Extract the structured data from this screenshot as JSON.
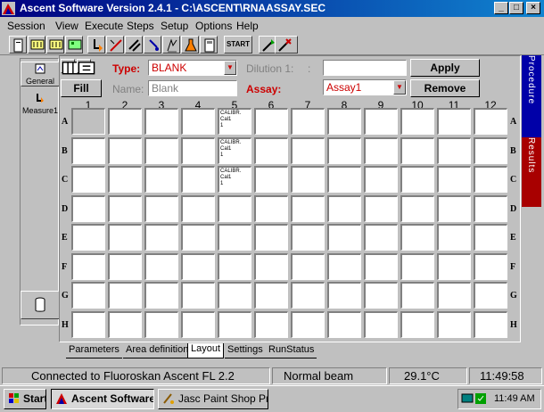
{
  "window": {
    "title": "Ascent Software Version 2.4.1     - C:\\ASCENT\\RNAASSAY.SEC",
    "minimize": "_",
    "maximize": "□",
    "close": "×"
  },
  "menu": [
    "Session",
    "View",
    "Execute",
    "Steps",
    "Setup",
    "Options",
    "Help"
  ],
  "toolbar": {
    "start_label": "START"
  },
  "leftnav": {
    "general": "General",
    "measure": "Measure1"
  },
  "form": {
    "type_label": "Type:",
    "type_value": "BLANK",
    "dilution_label": "Dilution 1:",
    "dilution_suffix": ":",
    "dilution_value": "",
    "apply": "Apply",
    "fill": "Fill",
    "name_label": "Name:",
    "name_value": "Blank",
    "assay_label": "Assay:",
    "assay_value": "Assay1",
    "remove": "Remove"
  },
  "plate": {
    "columns": [
      "1",
      "2",
      "3",
      "4",
      "5",
      "6",
      "7",
      "8",
      "9",
      "10",
      "11",
      "12"
    ],
    "rows": [
      "A",
      "B",
      "C",
      "D",
      "E",
      "F",
      "G",
      "H"
    ],
    "wells": {
      "A5": [
        "CALIBR.",
        "Cal1",
        "1"
      ],
      "B5": [
        "CALIBR.",
        "Cal1",
        "1"
      ],
      "C5": [
        "CALIBR.",
        "Cal1",
        "1"
      ]
    },
    "selected": "A1"
  },
  "tabs": [
    {
      "label": "Parameters",
      "active": false
    },
    {
      "label": "Area definition",
      "active": false
    },
    {
      "label": "Layout",
      "active": true
    },
    {
      "label": "Settings",
      "active": false
    },
    {
      "label": "RunStatus",
      "active": false
    }
  ],
  "side_tabs": {
    "procedure": "Procedure",
    "results": "Results"
  },
  "status": {
    "connection": "Connected to Fluoroskan Ascent FL 2.2",
    "mode": "Normal beam",
    "temperature": "29.1°C",
    "time": "11:49:58"
  },
  "taskbar": {
    "start": "Start",
    "apps": [
      {
        "label": "Ascent Software ...",
        "active": true
      },
      {
        "label": "Jasc Paint Shop Pro...",
        "active": false
      }
    ],
    "clock": "11:49 AM"
  },
  "colors": {
    "title_start": "#000080",
    "title_end": "#1084d0",
    "accent_red": "#cc0000",
    "procedure_tab": "#0000a8",
    "results_tab": "#a80000"
  }
}
